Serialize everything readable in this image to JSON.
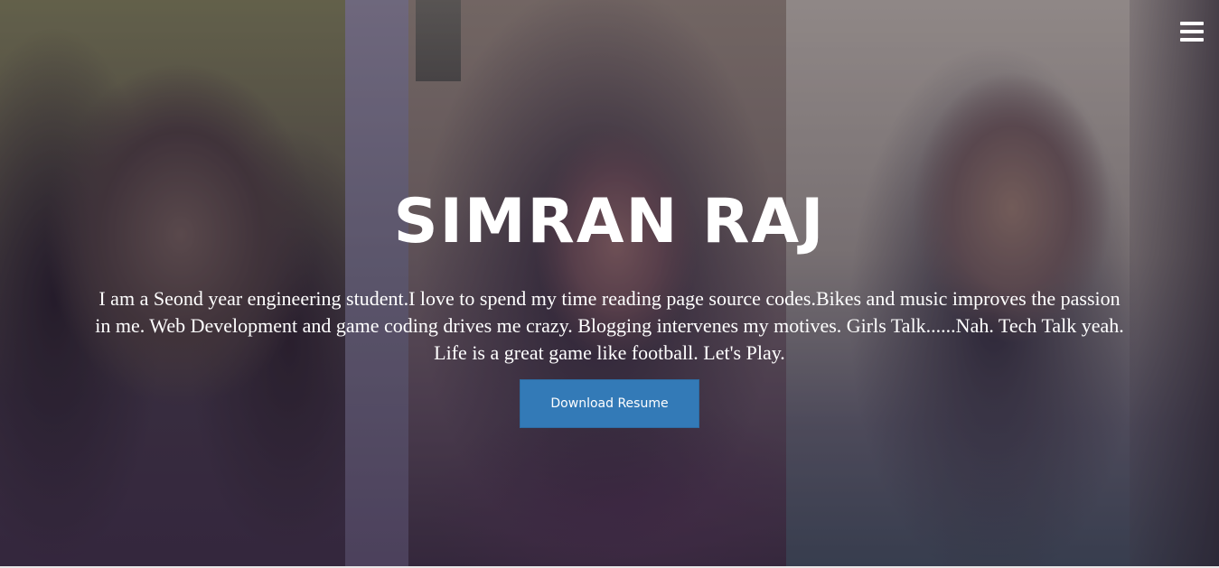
{
  "header": {
    "menu_icon": "hamburger-menu-icon"
  },
  "hero": {
    "title": "SIMRAN RAJ",
    "bio": "I am a Seond year engineering student.I love to spend my time reading page source codes.Bikes and music improves the passion in me. Web Development and game coding drives me crazy. Blogging intervenes my motives. Girls Talk......Nah. Tech Talk yeah. Life is a great game like football. Let's Play.",
    "download_button_label": "Download Resume"
  },
  "colors": {
    "button_primary": "#337ab7",
    "text": "#ffffff"
  }
}
